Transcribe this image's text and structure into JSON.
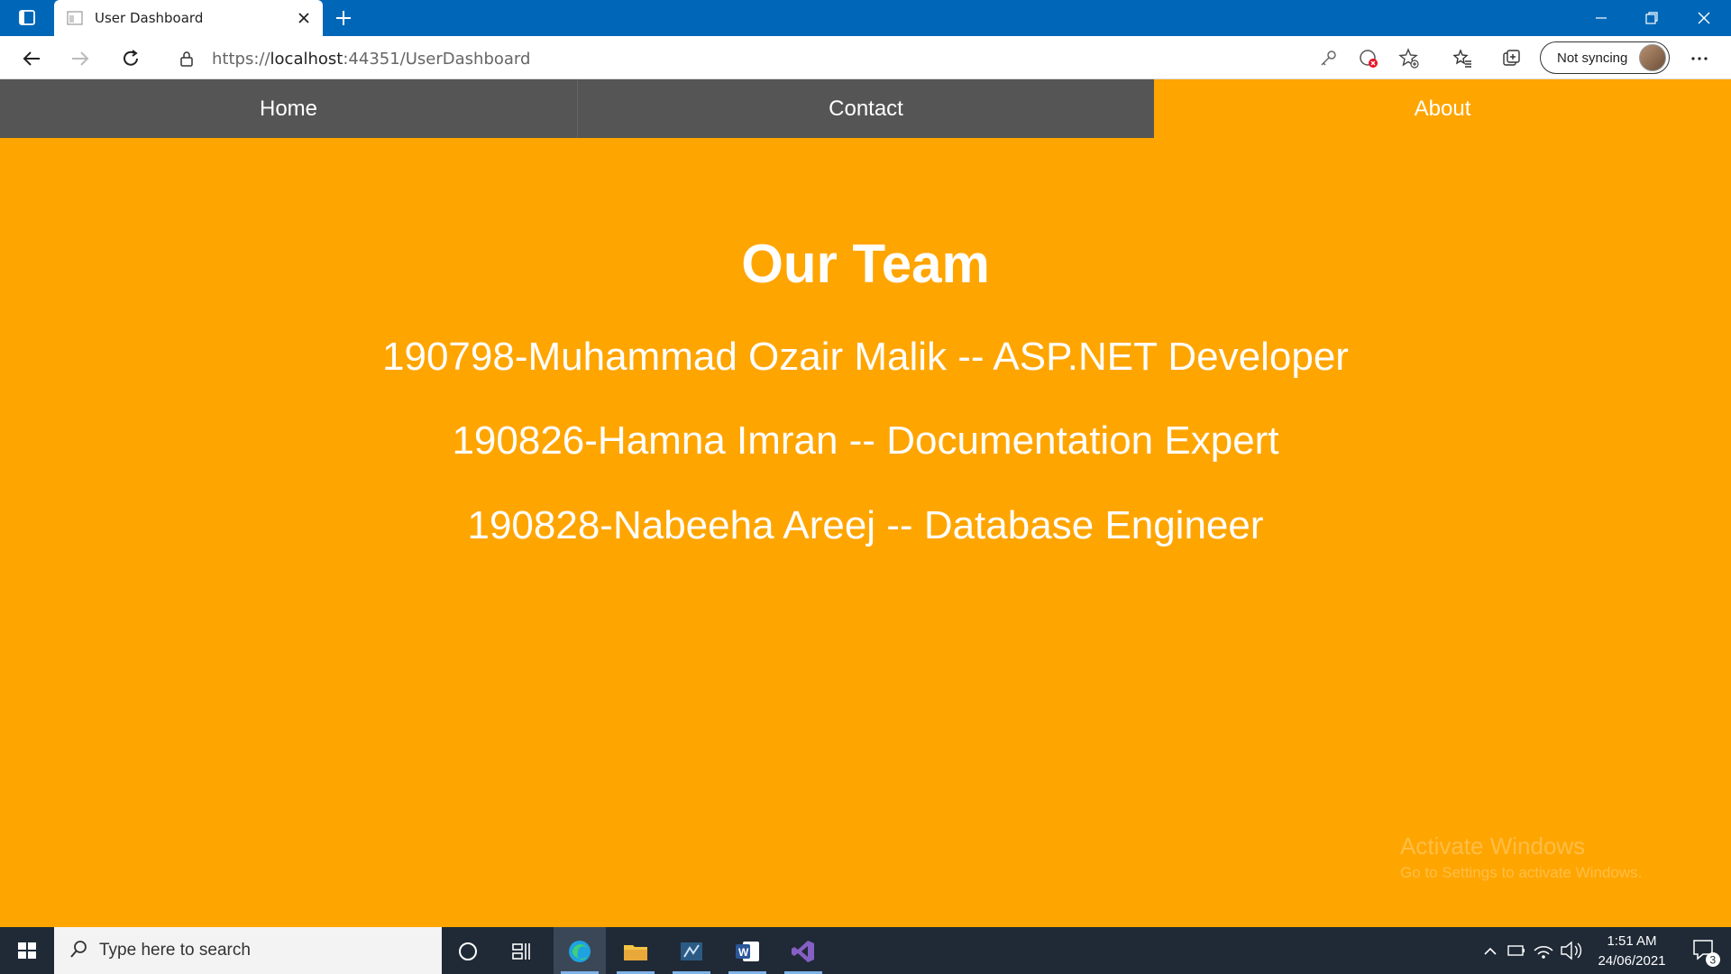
{
  "browser": {
    "tab_title": "User Dashboard",
    "url_prefix": "https://",
    "url_host": "localhost",
    "url_rest": ":44351/UserDashboard",
    "sync_label": "Not syncing"
  },
  "nav": {
    "home": "Home",
    "contact": "Contact",
    "about": "About"
  },
  "page": {
    "title": "Our Team",
    "members": [
      "190798-Muhammad Ozair Malik -- ASP.NET Developer",
      "190826-Hamna Imran -- Documentation Expert",
      "190828-Nabeeha Areej -- Database Engineer"
    ],
    "watermark_line1": "Activate Windows",
    "watermark_line2": "Go to Settings to activate Windows."
  },
  "taskbar": {
    "search_placeholder": "Type here to search",
    "time": "1:51 AM",
    "date": "24/06/2021",
    "notification_count": "3"
  },
  "colors": {
    "page_bg": "#ffa500",
    "nav_bg": "#555555",
    "browser_accent": "#0067b8",
    "taskbar_bg": "#1f2a36"
  }
}
